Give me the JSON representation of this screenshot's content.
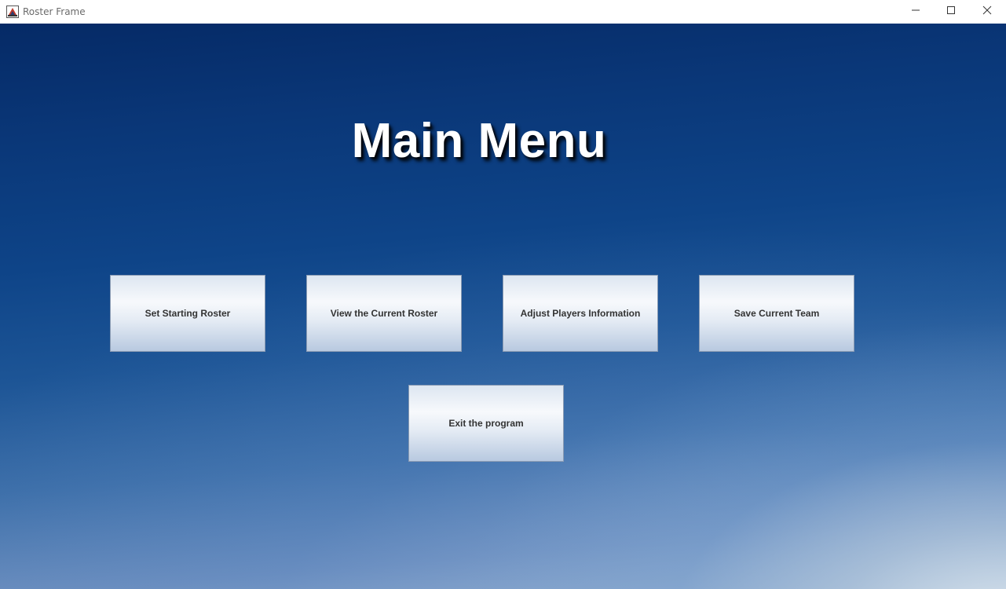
{
  "window": {
    "title": "Roster Frame",
    "icon": "java-app-icon",
    "controls": {
      "minimize_icon": "minimize-icon",
      "maximize_icon": "maximize-icon",
      "close_icon": "close-icon"
    }
  },
  "main": {
    "heading": "Main Menu",
    "buttons": [
      {
        "label": "Set Starting Roster"
      },
      {
        "label": "View the Current Roster"
      },
      {
        "label": "Adjust Players Information"
      },
      {
        "label": "Save Current Team"
      },
      {
        "label": "Exit the program"
      }
    ]
  },
  "colors": {
    "background_top": "#052a66",
    "background_bottom": "#9fb7d3",
    "heading": "#ffffff",
    "button_text": "#333333"
  }
}
